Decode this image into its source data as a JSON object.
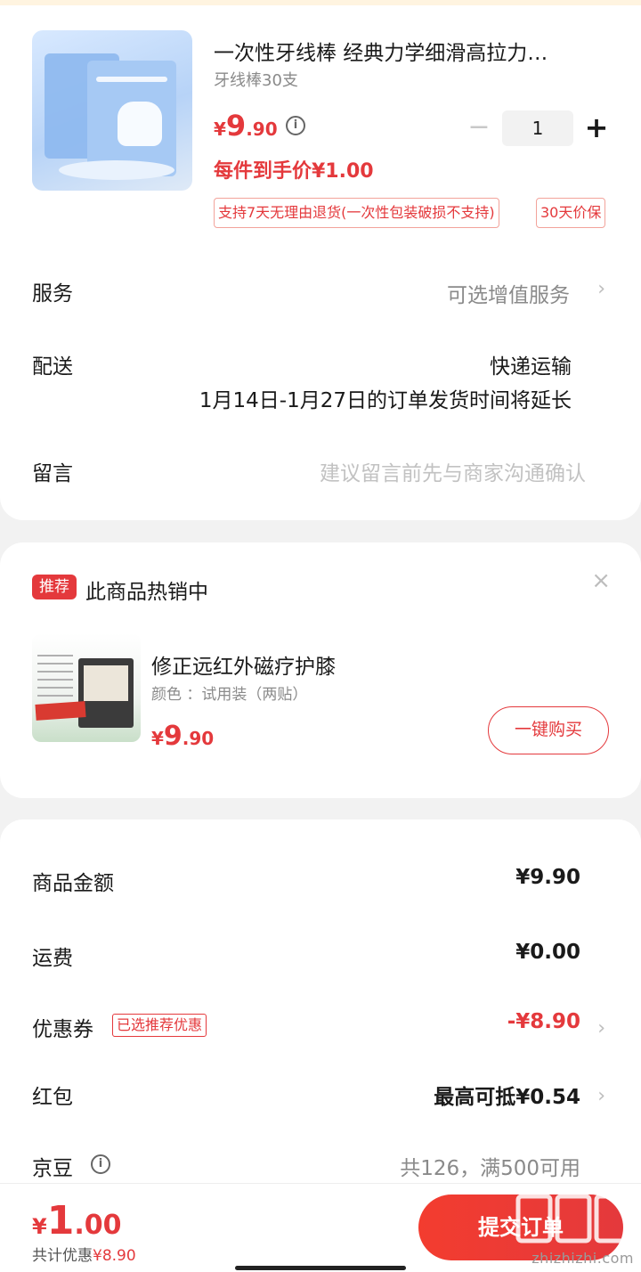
{
  "product": {
    "title": "一次性牙线棒  经典力学细滑高拉力…",
    "spec": "牙线棒30支",
    "price_currency": "¥",
    "price_int": "9",
    "price_dec": ".90",
    "info_icon": "info-icon",
    "quantity": "1",
    "minus": "−",
    "plus": "+",
    "unit_price": "每件到手价¥1.00",
    "tags": [
      "支持7天无理由退货(一次性包装破损不支持)",
      "30天价保"
    ]
  },
  "order_rows": {
    "service_label": "服务",
    "service_value": "可选增值服务",
    "shipping_label": "配送",
    "shipping_value": "快递运输",
    "shipping_note": "1月14日-1月27日的订单发货时间将延长",
    "message_label": "留言",
    "message_placeholder": "建议留言前先与商家沟通确认"
  },
  "recommend": {
    "badge": "推荐",
    "title": "此商品热销中",
    "close": "×",
    "item_name": "修正远红外磁疗护膝",
    "item_spec": "颜色 ：试用装（两贴）",
    "item_price_currency": "¥",
    "item_price_int": "9",
    "item_price_dec": ".90",
    "buy_label": "一键购买"
  },
  "summary": {
    "goods_label": "商品金额",
    "goods_value": "¥9.90",
    "freight_label": "运费",
    "freight_value": "¥0.00",
    "coupon_label": "优惠券",
    "coupon_tag": "已选推荐优惠",
    "coupon_value": "-¥8.90",
    "redpacket_label": "红包",
    "redpacket_value": "最高可抵¥0.54",
    "beans_label": "京豆",
    "beans_value": "共126，满500可用"
  },
  "bottom": {
    "total_currency": "¥",
    "total_int": "1",
    "total_dec": ".00",
    "saving_prefix": "共计优惠",
    "saving_value": "¥8.90",
    "submit_label": "提交订单",
    "watermark_text": "zhizhizhi.com",
    "watermark_logo": "值值值"
  },
  "colors": {
    "accent": "#e4393c",
    "background": "#f2f2f2"
  }
}
